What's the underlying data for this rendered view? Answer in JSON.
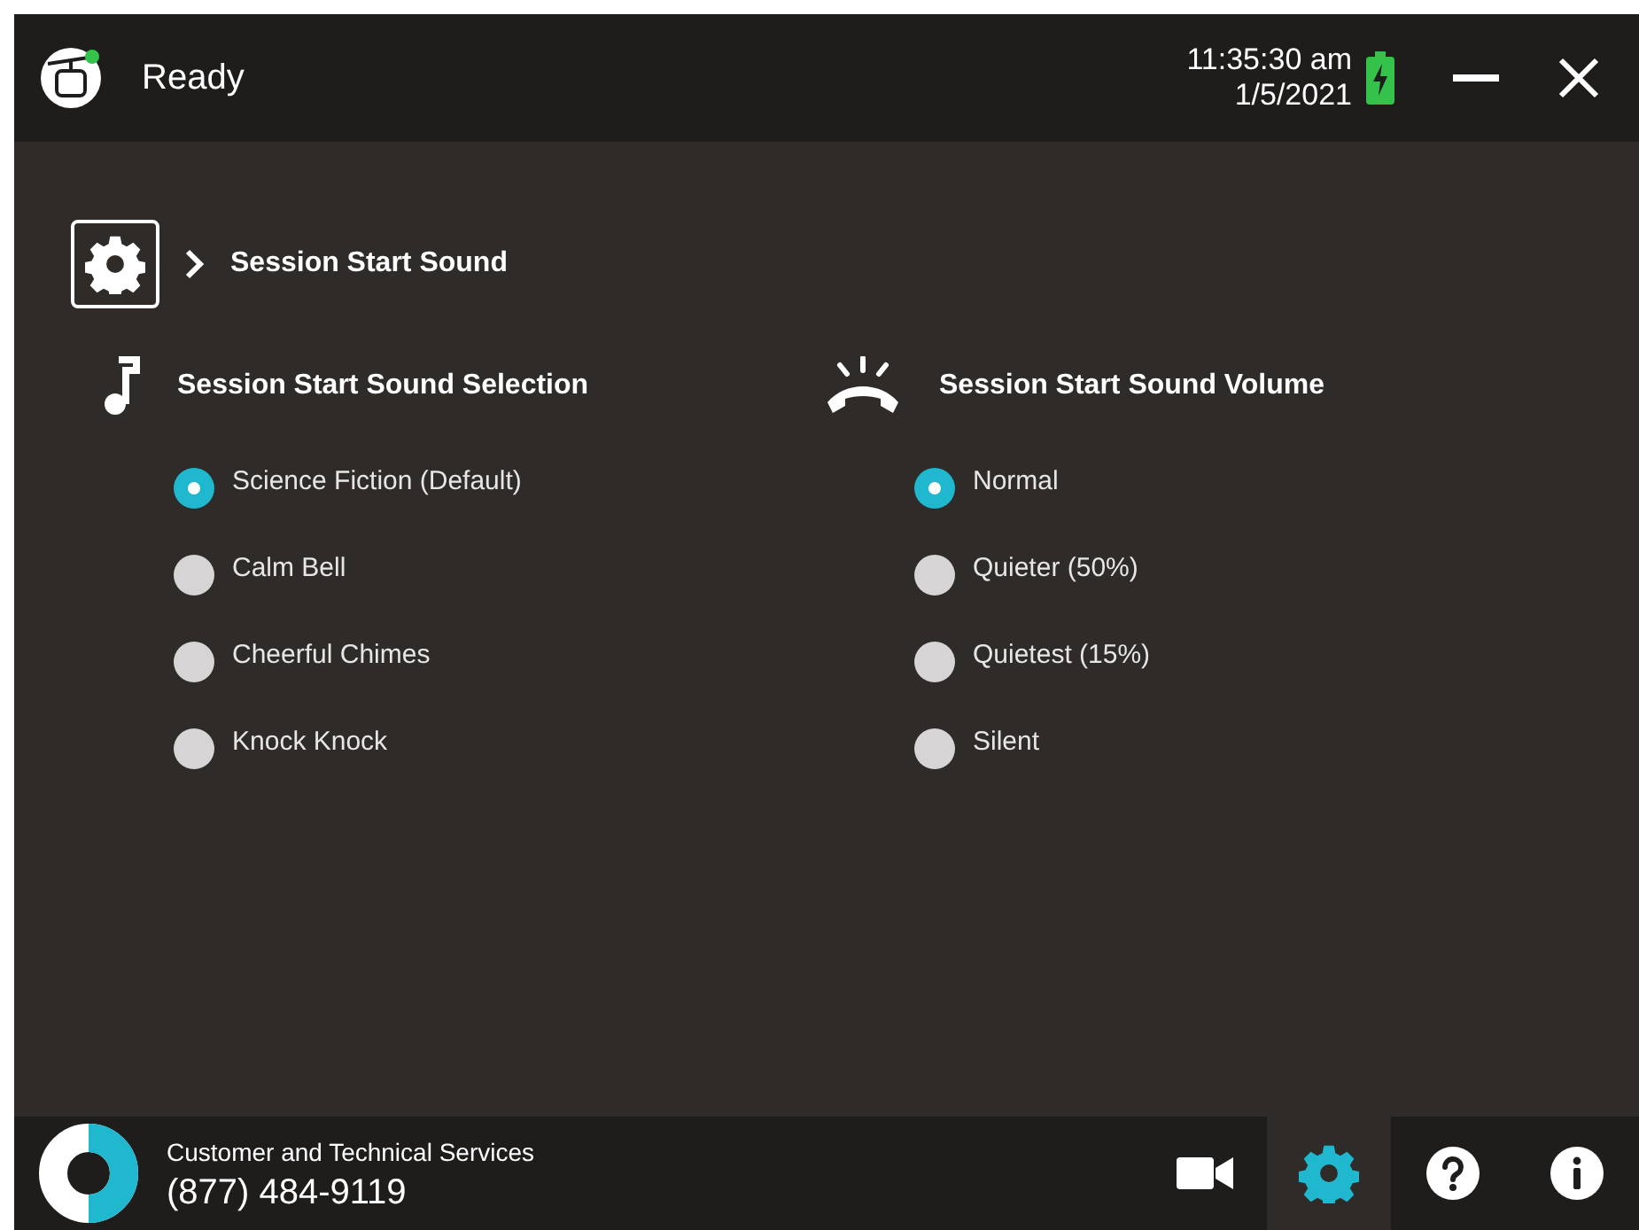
{
  "title_bar": {
    "status": "Ready",
    "time": "11:35:30 am",
    "date": "1/5/2021",
    "battery_charging": true
  },
  "breadcrumb": {
    "title": "Session Start Sound"
  },
  "groups": [
    {
      "kind": "music",
      "title": "Session Start Sound Selection",
      "options": [
        {
          "label": "Science Fiction (Default)",
          "selected": true
        },
        {
          "label": "Calm Bell",
          "selected": false
        },
        {
          "label": "Cheerful Chimes",
          "selected": false
        },
        {
          "label": "Knock Knock",
          "selected": false
        }
      ]
    },
    {
      "kind": "ring",
      "title": "Session Start Sound Volume",
      "options": [
        {
          "label": "Normal",
          "selected": true
        },
        {
          "label": "Quieter (50%)",
          "selected": false
        },
        {
          "label": "Quietest (15%)",
          "selected": false
        },
        {
          "label": "Silent",
          "selected": false
        }
      ]
    }
  ],
  "footer": {
    "label": "Customer and Technical Services",
    "phone": "(877) 484-9119",
    "tools": [
      {
        "kind": "video",
        "selected": false
      },
      {
        "kind": "settings",
        "selected": true
      },
      {
        "kind": "help",
        "selected": false
      },
      {
        "kind": "info",
        "selected": false
      }
    ]
  }
}
